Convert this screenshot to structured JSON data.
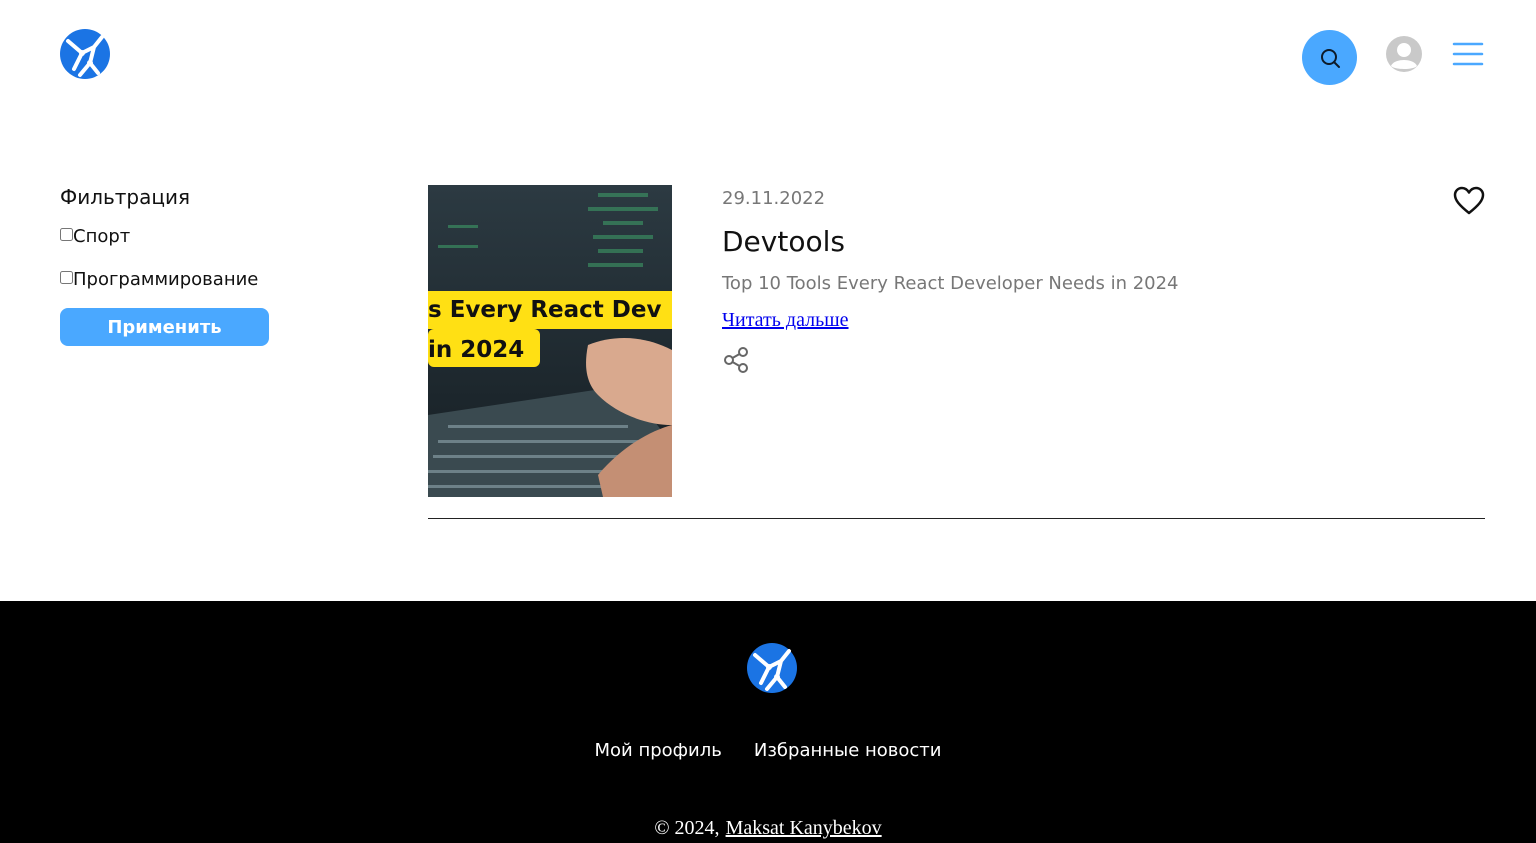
{
  "header": {
    "logo_icon": "globe-logo-icon",
    "search_icon": "search-icon",
    "profile_icon": "user-avatar-icon",
    "menu_icon": "hamburger-menu-icon",
    "accent_color": "#4aa8ff"
  },
  "filter": {
    "title": "Фильтрация",
    "options": [
      {
        "label": "Спорт",
        "checked": false
      },
      {
        "label": "Программирование",
        "checked": false
      }
    ],
    "apply_label": "Применить"
  },
  "news": [
    {
      "date": "29.11.2022",
      "title": "Devtools",
      "description": "Top 10 Tools Every React Developer Needs in 2024",
      "read_more": "Читать дальше",
      "image_text": [
        "s Every React Dev",
        "in 2024"
      ],
      "liked": false
    }
  ],
  "footer": {
    "links": [
      "Мой профиль",
      "Избранные новости"
    ],
    "copyright": "© 2024,",
    "author": "Maksat Kanybekov"
  }
}
